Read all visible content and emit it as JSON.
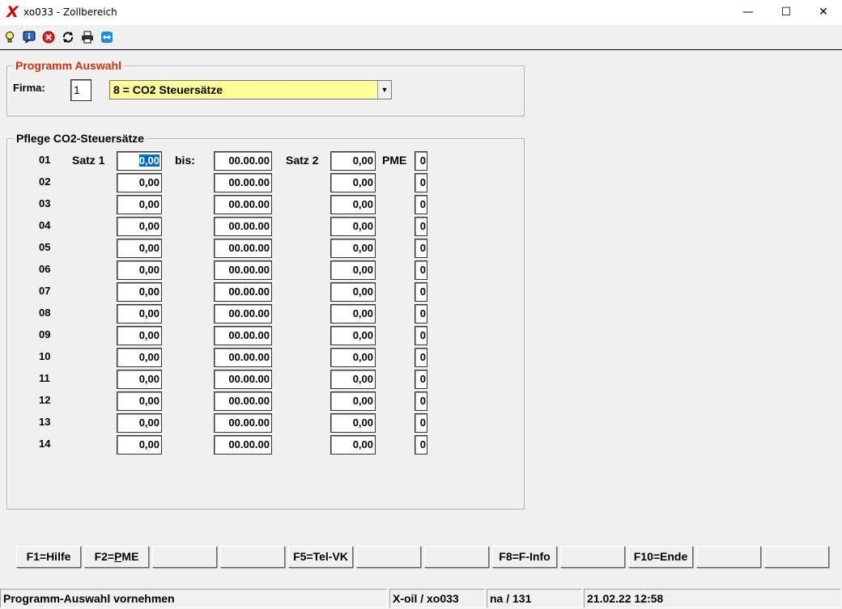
{
  "window": {
    "title": "xo033 - Zollbereich",
    "minimize": "—",
    "maximize": "☐",
    "close": "✕"
  },
  "toolbar": {
    "icons": [
      "lightbulb-icon",
      "info-icon",
      "cancel-icon",
      "refresh-icon",
      "print-icon",
      "teamviewer-icon"
    ]
  },
  "programm": {
    "legend": "Programm Auswahl",
    "firma_label": "Firma:",
    "firma_value": "1",
    "selection": "8 = CO2 Steuersätze"
  },
  "pflege": {
    "legend": "Pflege CO2-Steuersätze",
    "headers": {
      "satz1": "Satz 1",
      "bis": "bis:",
      "satz2": "Satz 2",
      "pme": "PME"
    },
    "rows": [
      {
        "nr": "01",
        "satz1": "0,00",
        "bis": "00.00.00",
        "satz2": "0,00",
        "pme": "0"
      },
      {
        "nr": "02",
        "satz1": "0,00",
        "bis": "00.00.00",
        "satz2": "0,00",
        "pme": "0"
      },
      {
        "nr": "03",
        "satz1": "0,00",
        "bis": "00.00.00",
        "satz2": "0,00",
        "pme": "0"
      },
      {
        "nr": "04",
        "satz1": "0,00",
        "bis": "00.00.00",
        "satz2": "0,00",
        "pme": "0"
      },
      {
        "nr": "05",
        "satz1": "0,00",
        "bis": "00.00.00",
        "satz2": "0,00",
        "pme": "0"
      },
      {
        "nr": "06",
        "satz1": "0,00",
        "bis": "00.00.00",
        "satz2": "0,00",
        "pme": "0"
      },
      {
        "nr": "07",
        "satz1": "0,00",
        "bis": "00.00.00",
        "satz2": "0,00",
        "pme": "0"
      },
      {
        "nr": "08",
        "satz1": "0,00",
        "bis": "00.00.00",
        "satz2": "0,00",
        "pme": "0"
      },
      {
        "nr": "09",
        "satz1": "0,00",
        "bis": "00.00.00",
        "satz2": "0,00",
        "pme": "0"
      },
      {
        "nr": "10",
        "satz1": "0,00",
        "bis": "00.00.00",
        "satz2": "0,00",
        "pme": "0"
      },
      {
        "nr": "11",
        "satz1": "0,00",
        "bis": "00.00.00",
        "satz2": "0,00",
        "pme": "0"
      },
      {
        "nr": "12",
        "satz1": "0,00",
        "bis": "00.00.00",
        "satz2": "0,00",
        "pme": "0"
      },
      {
        "nr": "13",
        "satz1": "0,00",
        "bis": "00.00.00",
        "satz2": "0,00",
        "pme": "0"
      },
      {
        "nr": "14",
        "satz1": "0,00",
        "bis": "00.00.00",
        "satz2": "0,00",
        "pme": "0"
      }
    ]
  },
  "fkeys": [
    "F1=Hilfe",
    "F2=PME",
    "",
    "",
    "F5=Tel-VK",
    "",
    "",
    "F8=F-Info",
    "",
    "F10=Ende",
    "",
    ""
  ],
  "status": {
    "message": "Programm-Auswahl vornehmen",
    "app": "X-oil / xo033",
    "user": "na / 131",
    "datetime": "21.02.22 12:58"
  }
}
